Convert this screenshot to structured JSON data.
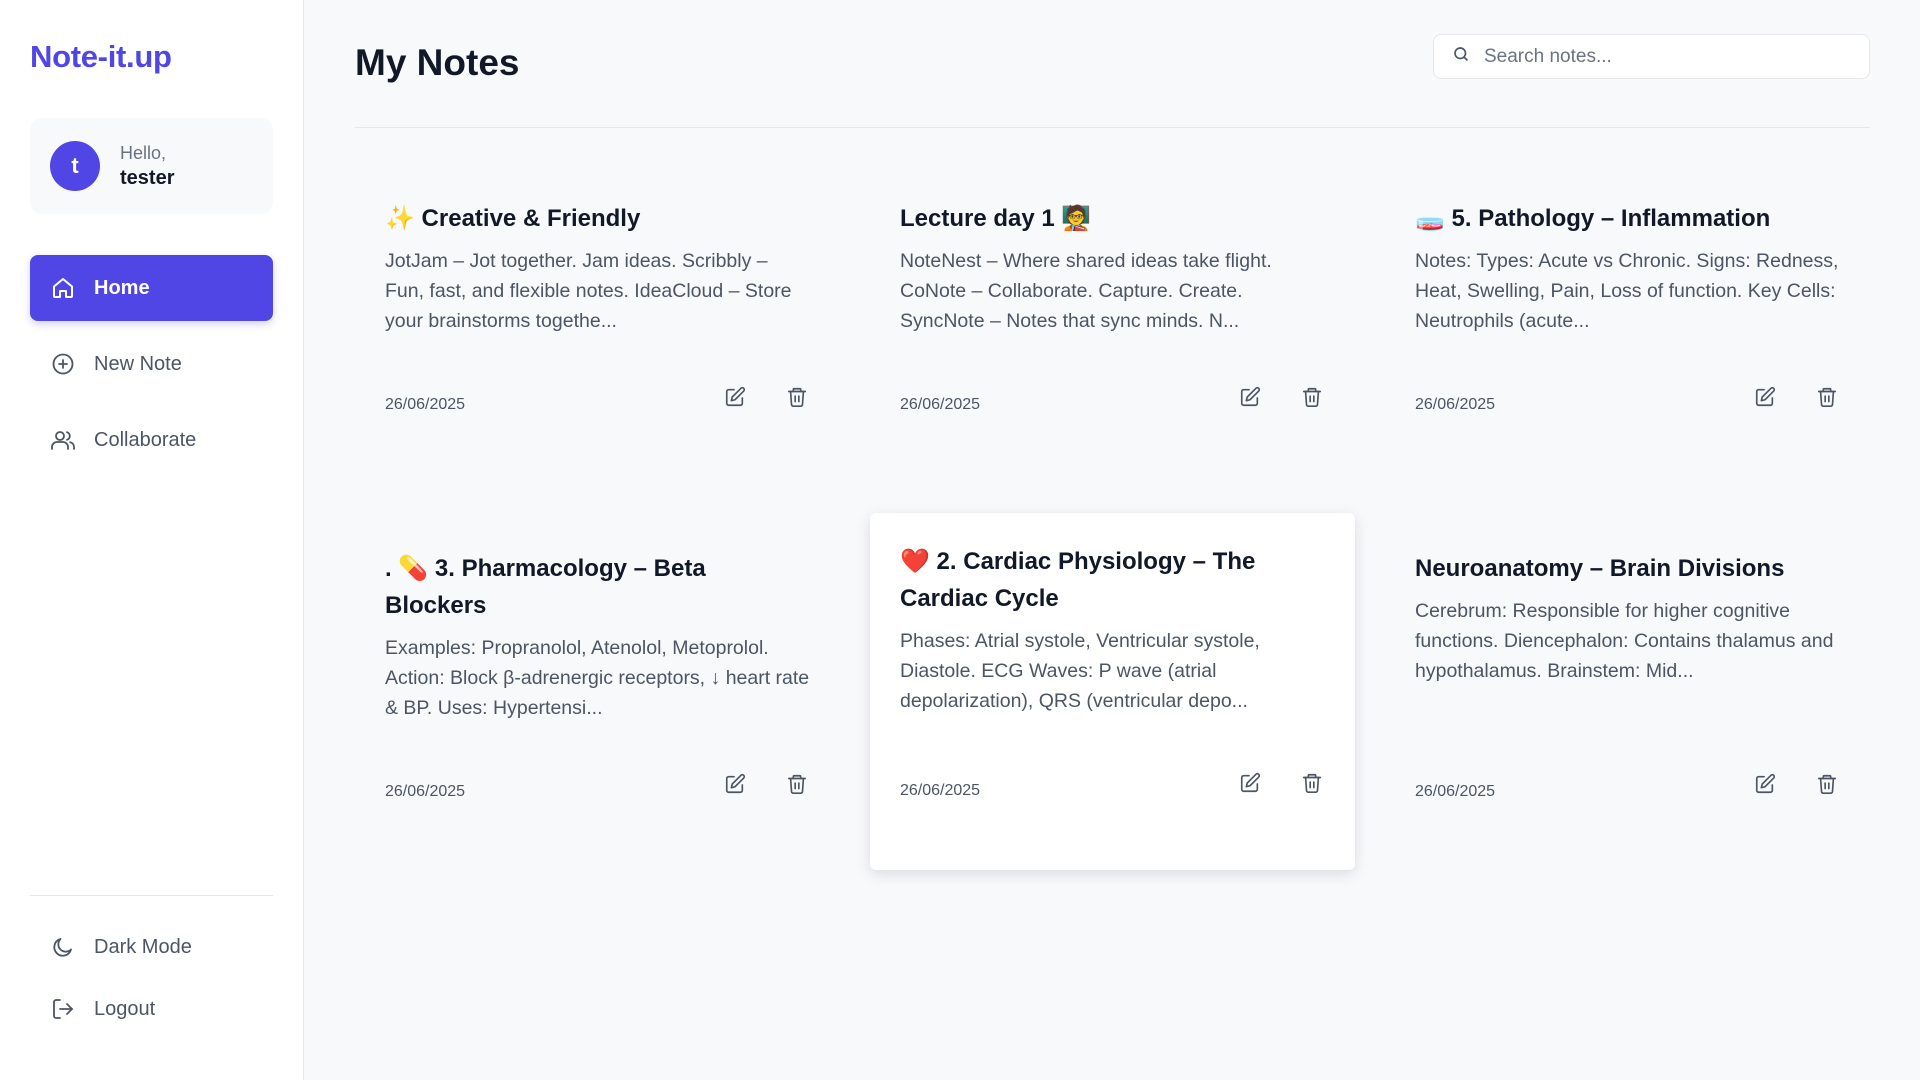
{
  "brand": "Note-it.up",
  "user": {
    "initial": "t",
    "greeting": "Hello,",
    "name": "tester"
  },
  "nav": {
    "home": "Home",
    "new_note": "New Note",
    "collaborate": "Collaborate"
  },
  "bottom": {
    "dark_mode": "Dark Mode",
    "logout": "Logout"
  },
  "header": {
    "title": "My Notes",
    "search_placeholder": "Search notes..."
  },
  "notes": [
    {
      "title": "✨ Creative & Friendly",
      "preview": "JotJam – Jot together. Jam ideas. Scribbly – Fun, fast, and flexible notes. IdeaCloud – Store your brainstorms togethe...",
      "date": "26/06/2025"
    },
    {
      "title": "Lecture day 1 🧑‍🏫",
      "preview": "NoteNest – Where shared ideas take flight. CoNote – Collaborate. Capture. Create. SyncNote – Notes that sync minds. N...",
      "date": "26/06/2025"
    },
    {
      "title": "🧫 5. Pathology – Inflammation",
      "preview": "Notes: Types: Acute vs Chronic. Signs: Redness, Heat, Swelling, Pain, Loss of function. Key Cells: Neutrophils (acute...",
      "date": "26/06/2025"
    },
    {
      "title": ". 💊 3. Pharmacology – Beta Blockers",
      "preview": "Examples: Propranolol, Atenolol, Metoprolol. Action: Block β-adrenergic receptors, ↓ heart rate & BP. Uses: Hypertensi...",
      "date": "26/06/2025"
    },
    {
      "title": "❤️ 2. Cardiac Physiology – The Cardiac Cycle",
      "preview": "Phases: Atrial systole, Ventricular systole, Diastole. ECG Waves: P wave (atrial depolarization), QRS (ventricular depo...",
      "date": "26/06/2025"
    },
    {
      "title": "Neuroanatomy – Brain Divisions",
      "preview": "Cerebrum: Responsible for higher cognitive functions. Diencephalon: Contains thalamus and hypothalamus. Brainstem: Mid...",
      "date": "26/06/2025"
    }
  ],
  "colors": {
    "accent": "#4f46e5",
    "background": "#f8f9fb",
    "text_muted": "#4b5563"
  },
  "icons": [
    "home-icon",
    "plus-circle-icon",
    "users-icon",
    "moon-icon",
    "logout-icon",
    "search-icon",
    "edit-icon",
    "trash-icon"
  ]
}
